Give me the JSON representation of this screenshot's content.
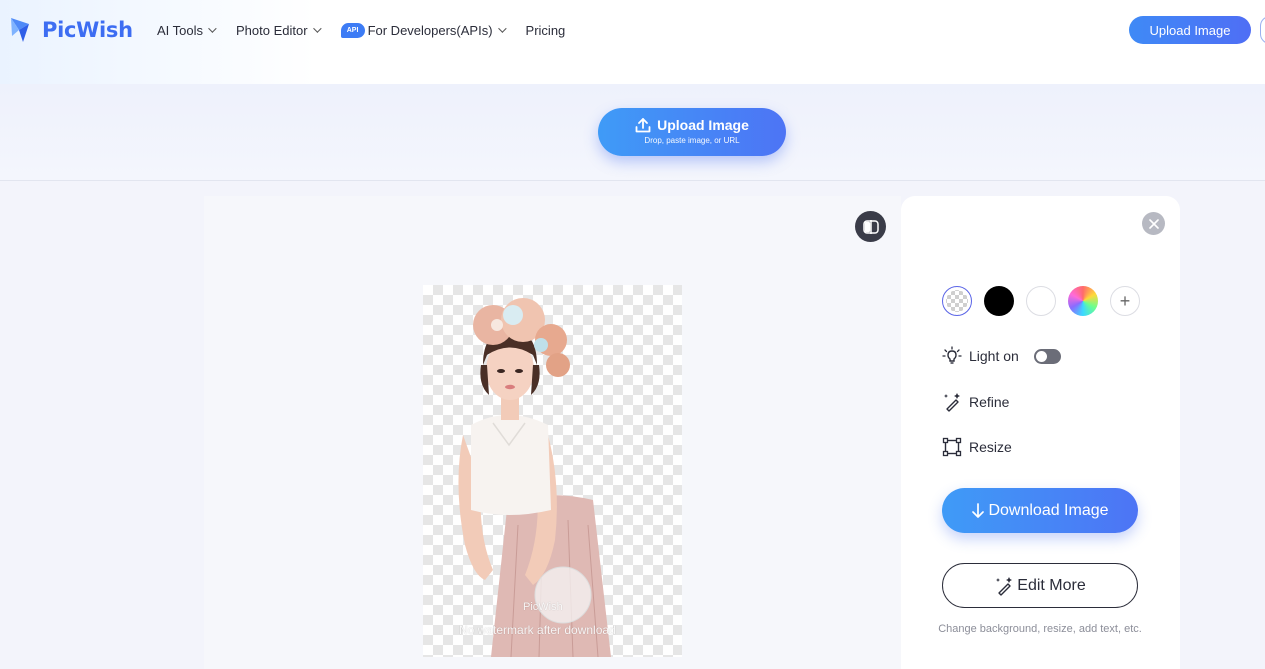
{
  "header": {
    "logo_text": "PicWish",
    "nav": [
      {
        "label": "AI Tools",
        "has_dropdown": true
      },
      {
        "label": "Photo Editor",
        "has_dropdown": true
      },
      {
        "label": "For Developers(APIs)",
        "badge": "API",
        "has_dropdown": true
      },
      {
        "label": "Pricing",
        "has_dropdown": false
      }
    ],
    "upload_button": "Upload Image"
  },
  "upload": {
    "label": "Upload Image",
    "sublabel": "Drop, paste image, or URL"
  },
  "preview": {
    "watermark_brand": "PicWish",
    "watermark_note": "No watermark after download"
  },
  "panel": {
    "backgrounds": [
      "transparent",
      "#000000",
      "#ffffff",
      "rainbow",
      "add"
    ],
    "light_label": "Light on",
    "light_on": false,
    "refine_label": "Refine",
    "resize_label": "Resize",
    "download_label": "Download Image",
    "edit_label": "Edit More",
    "edit_note": "Change background, resize, add text, etc."
  },
  "colors": {
    "brand": "#3d6df2",
    "accent_gradient_start": "#3f9bf7",
    "accent_gradient_end": "#4d74f5"
  }
}
